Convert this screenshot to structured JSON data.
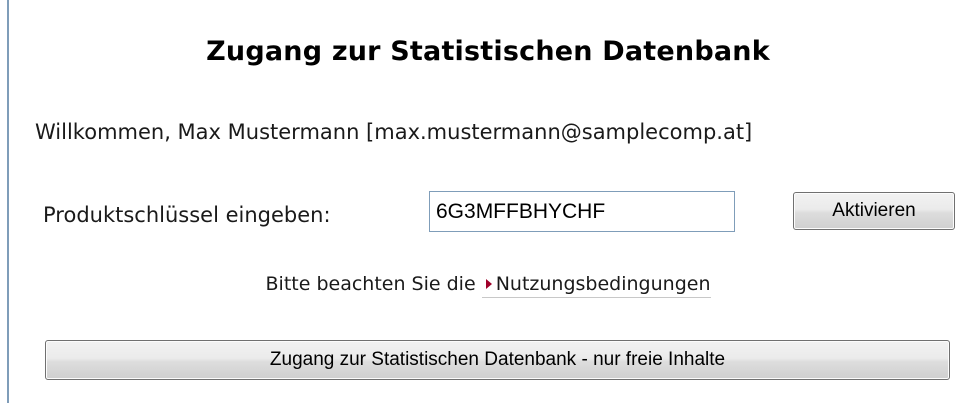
{
  "page": {
    "title": "Zugang zur Statistischen Datenbank",
    "welcome": "Willkommen, Max Mustermann [max.mustermann@samplecomp.at]"
  },
  "activation": {
    "label": "Produktschlüssel eingeben:",
    "key_value": "6G3MFFBHYCHF",
    "activate_label": "Aktivieren"
  },
  "terms": {
    "prefix": "Bitte beachten Sie die",
    "link_label": "Nutzungsbedingungen",
    "link_icon": "red-arrow-icon"
  },
  "access": {
    "button_label": "Zugang zur Statistischen Datenbank - nur freie Inhalte"
  },
  "colors": {
    "link_arrow": "#a0002a",
    "input_border": "#7f9db9"
  }
}
